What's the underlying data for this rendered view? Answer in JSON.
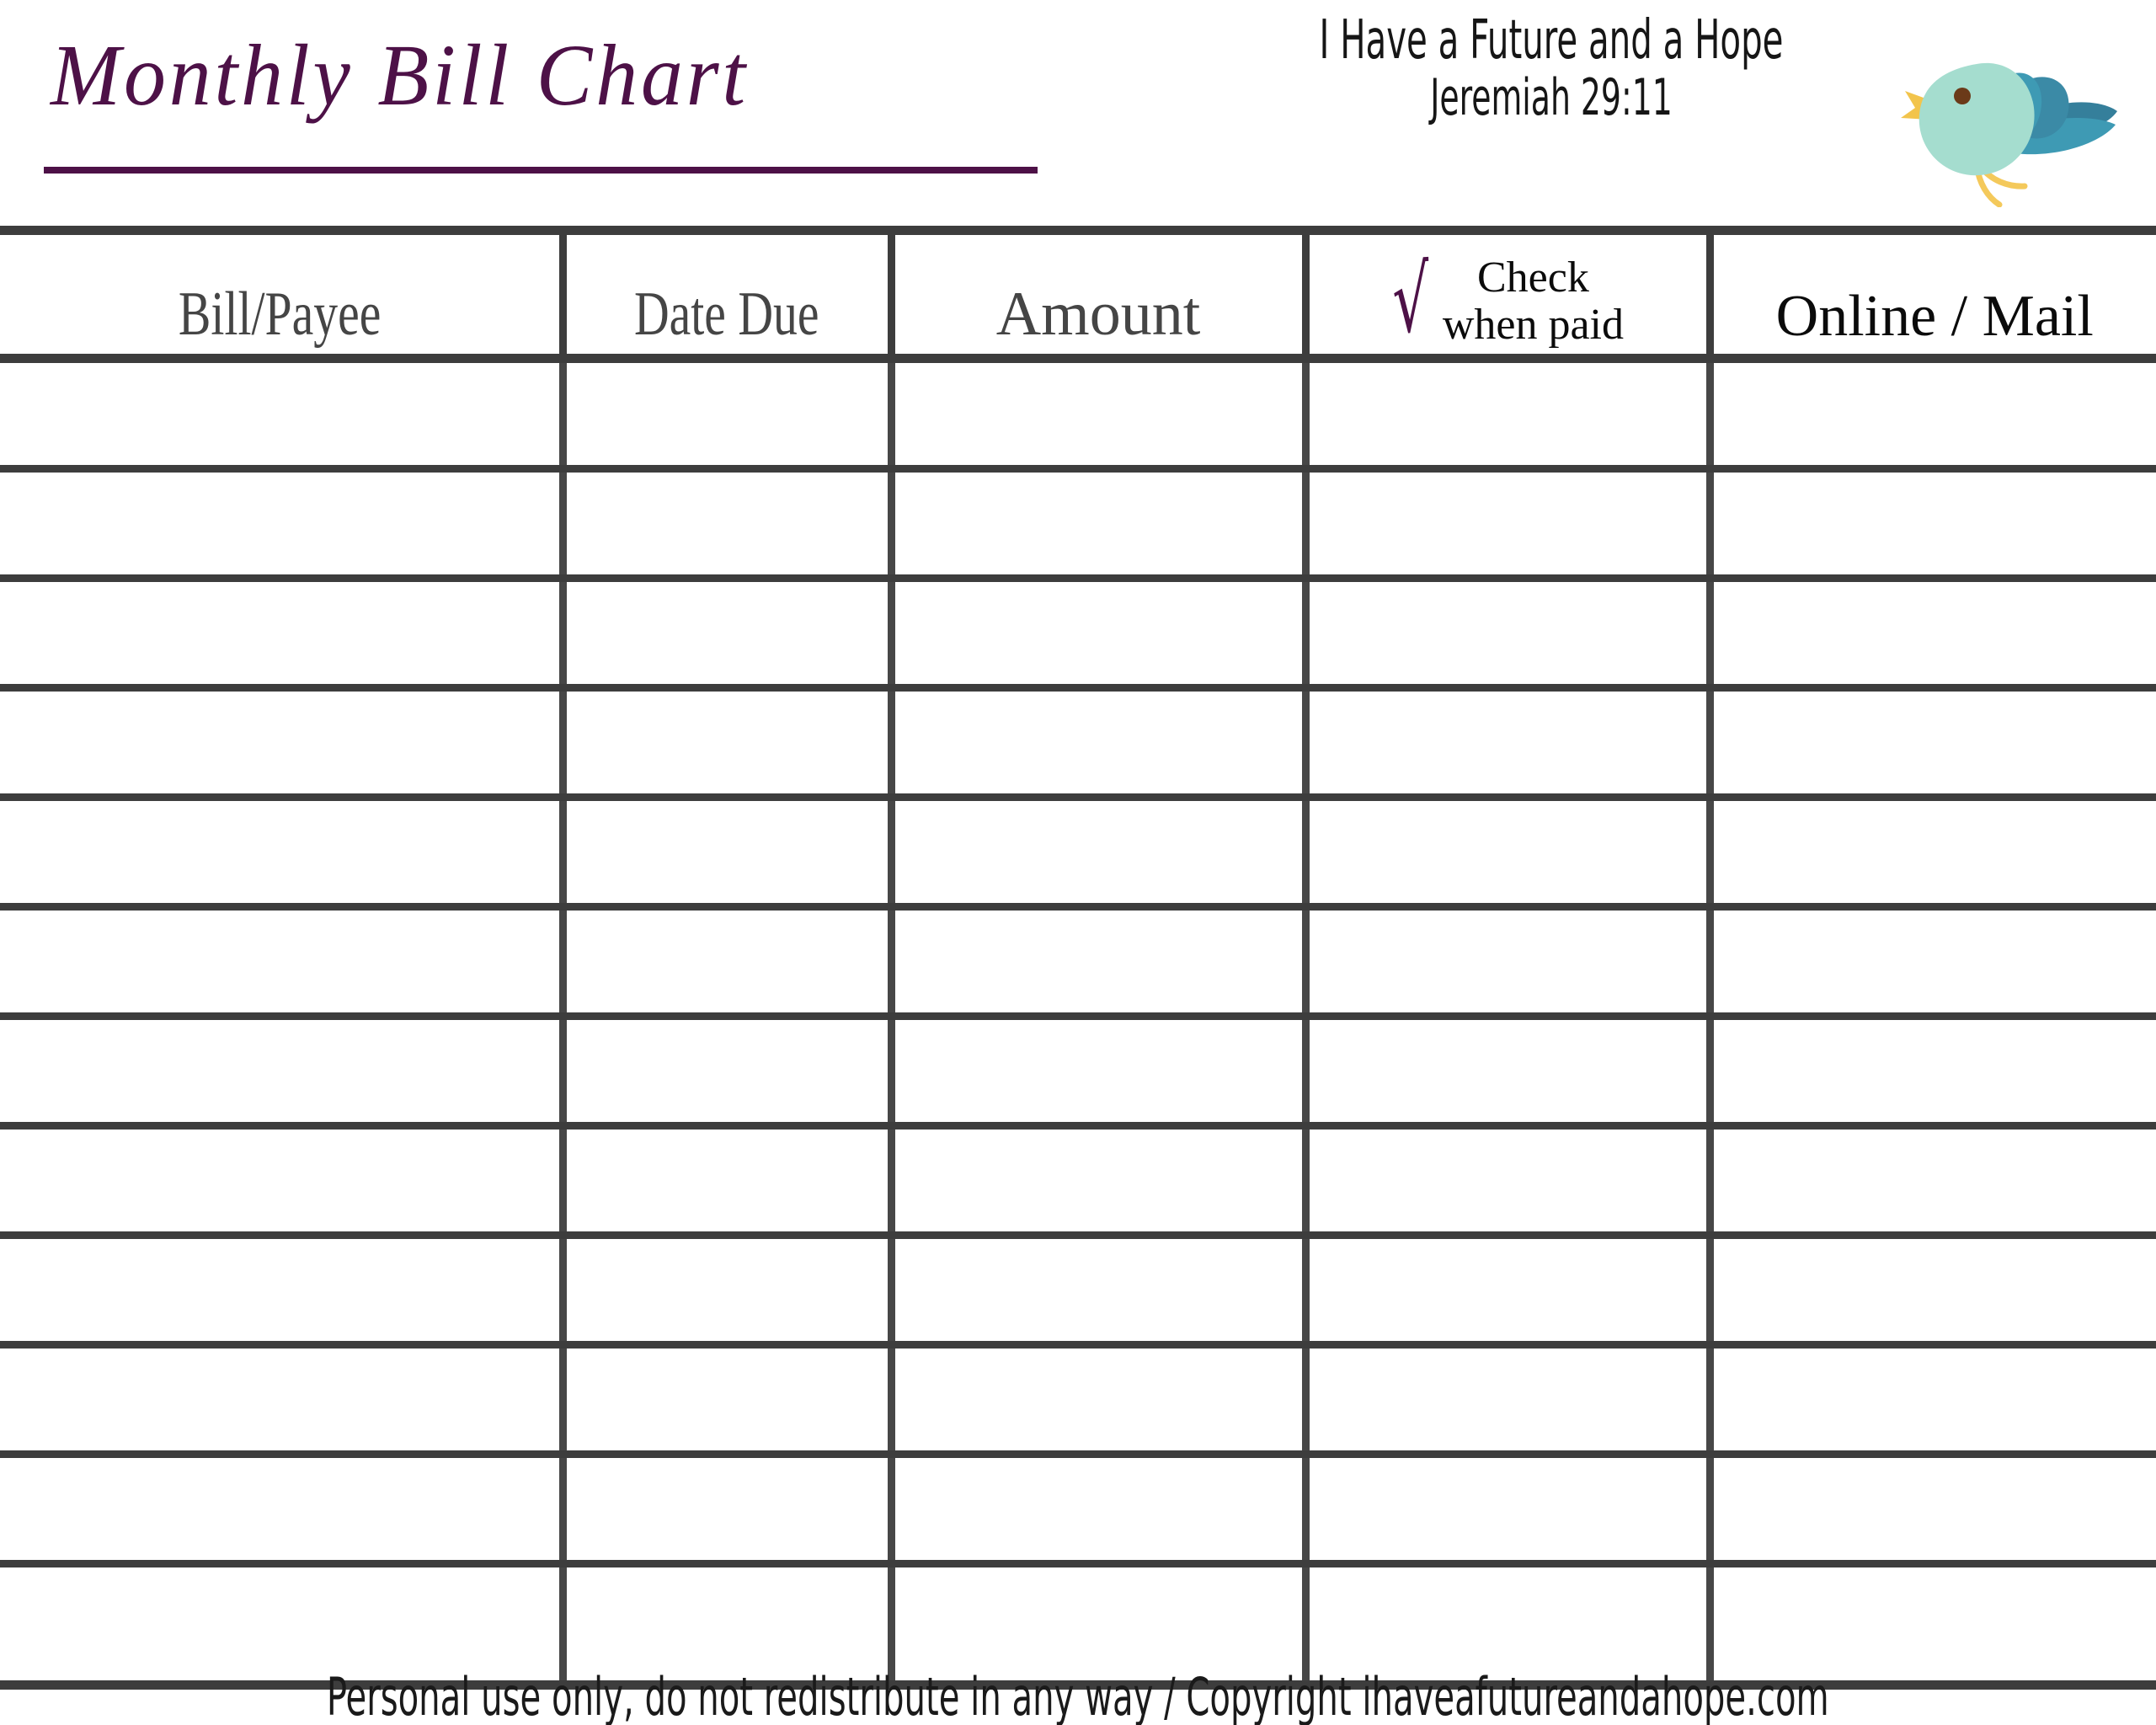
{
  "document": {
    "title": "Monthly Bill Chart",
    "tagline_line1": "I Have a Future and a Hope",
    "tagline_line2": "Jeremiah 29:11",
    "footer": "Personal use only, do not redistribute in any way / Copyright ihaveafutureandahope.com"
  },
  "colors": {
    "title_purple": "#4d1147",
    "checkmark_purple": "#4d1147",
    "grid_gray": "#3d3d3d",
    "header_text_gray": "#454545",
    "header_text_black": "#0b0b0b",
    "bird_body": "#a5ddcf",
    "bird_wing": "#3e9ab4",
    "bird_wing_dark": "#3b8aa6",
    "bird_tail": "#357f9b",
    "bird_beak": "#f2c44c",
    "bird_legs": "#f4c95b",
    "bird_eye": "#6b3a19",
    "page_background": "#ffffff"
  },
  "table": {
    "columns": [
      {
        "label": "Bill/Payee",
        "style": "narrow-gray"
      },
      {
        "label": "Date Due",
        "style": "narrow-gray"
      },
      {
        "label": "Amount",
        "style": "wide-gray"
      },
      {
        "label_line1": "Check",
        "label_line2": "when paid",
        "icon": "checkmark-icon",
        "style": "check"
      },
      {
        "label": "Online / Mail",
        "style": "wide-black"
      }
    ],
    "row_count": 12,
    "rows": [
      [
        "",
        "",
        "",
        "",
        ""
      ],
      [
        "",
        "",
        "",
        "",
        ""
      ],
      [
        "",
        "",
        "",
        "",
        ""
      ],
      [
        "",
        "",
        "",
        "",
        ""
      ],
      [
        "",
        "",
        "",
        "",
        ""
      ],
      [
        "",
        "",
        "",
        "",
        ""
      ],
      [
        "",
        "",
        "",
        "",
        ""
      ],
      [
        "",
        "",
        "",
        "",
        ""
      ],
      [
        "",
        "",
        "",
        "",
        ""
      ],
      [
        "",
        "",
        "",
        "",
        ""
      ],
      [
        "",
        "",
        "",
        "",
        ""
      ],
      [
        "",
        "",
        "",
        "",
        ""
      ]
    ]
  },
  "icons": {
    "checkmark": "√",
    "bird": "bird-illustration"
  }
}
